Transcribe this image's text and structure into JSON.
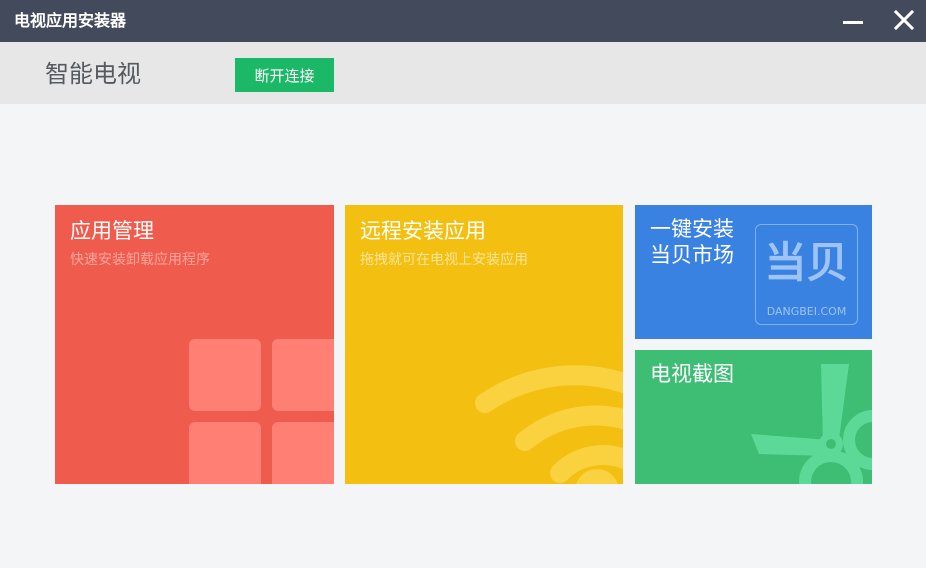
{
  "window": {
    "title": "电视应用安装器"
  },
  "toolbar": {
    "device_name": "智能电视",
    "disconnect_label": "断开连接"
  },
  "tiles": {
    "app_manage": {
      "title": "应用管理",
      "subtitle": "快速安装卸载应用程序",
      "color": "#ef5c4e"
    },
    "remote_install": {
      "title": "远程安装应用",
      "subtitle": "拖拽就可在电视上安装应用",
      "color": "#f3bf11"
    },
    "dangbei_market": {
      "title": "一键安装\n当贝市场",
      "logo_text": "当贝",
      "logo_caption": "DANGBEI.COM",
      "color": "#3a82e2"
    },
    "tv_screenshot": {
      "title": "电视截图",
      "color": "#3dbe74"
    }
  },
  "icons": [
    "minimize-icon",
    "close-icon",
    "grid-icon",
    "wifi-icon",
    "dangbei-logo",
    "scissors-icon"
  ]
}
